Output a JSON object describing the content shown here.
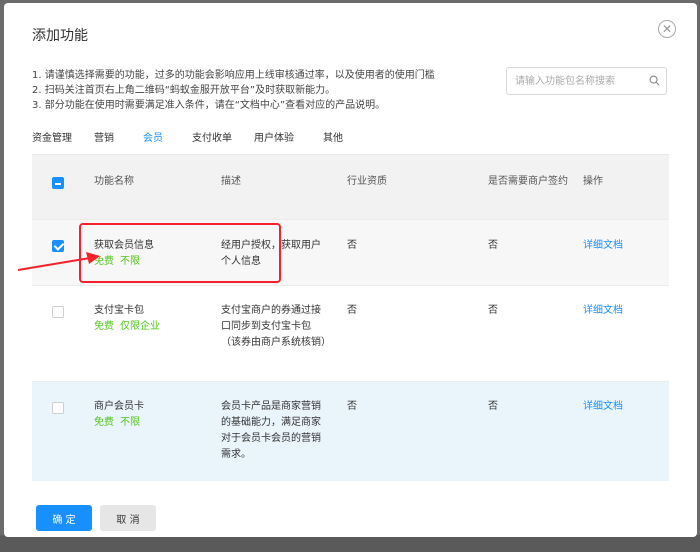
{
  "modal": {
    "title": "添加功能",
    "close_icon": "close-icon"
  },
  "notes": [
    "1. 请谨慎选择需要的功能，过多的功能会影响应用上线审核通过率，以及使用者的使用门槛",
    "2. 扫码关注首页右上角二维码“蚂蚁金服开放平台”及时获取新能力。",
    "3. 部分功能在使用时需要满足准入条件，请在“文档中心”查看对应的产品说明。"
  ],
  "search": {
    "placeholder": "请输入功能包名称搜索",
    "value": "",
    "icon": "search-icon"
  },
  "tabs": [
    {
      "label": "资金管理",
      "active": false
    },
    {
      "label": "营销",
      "active": false
    },
    {
      "label": "会员",
      "active": true
    },
    {
      "label": "支付收单",
      "active": false
    },
    {
      "label": "用户体验",
      "active": false
    },
    {
      "label": "其他",
      "active": false
    }
  ],
  "table": {
    "headers": {
      "name": "功能名称",
      "desc": "描述",
      "industry": "行业资质",
      "merchant": "是否需要商户签约",
      "op": "操作"
    },
    "rows": [
      {
        "checked": true,
        "name": "获取会员信息",
        "tag1": "免费",
        "tag2": "不限",
        "desc": "经用户授权，获取用户个人信息",
        "industry": "否",
        "merchant": "否",
        "op": "详细文档"
      },
      {
        "checked": false,
        "name": "支付宝卡包",
        "tag1": "免费",
        "tag2": "仅限企业",
        "desc": "支付宝商户的券通过接口同步到支付宝卡包（该券由商户系统核销）",
        "industry": "否",
        "merchant": "否",
        "op": "详细文档"
      },
      {
        "checked": false,
        "name": "商户会员卡",
        "tag1": "免费",
        "tag2": "不限",
        "desc": "会员卡产品是商家营销的基础能力，满足商家对于会员卡会员的营销需求。",
        "industry": "否",
        "merchant": "否",
        "op": "详细文档"
      }
    ]
  },
  "footer": {
    "ok_label": "确 定",
    "cancel_label": "取 消"
  },
  "colors": {
    "accent": "#1890ff",
    "tag_green": "#52c41a",
    "annotation_red": "#f5222d"
  }
}
